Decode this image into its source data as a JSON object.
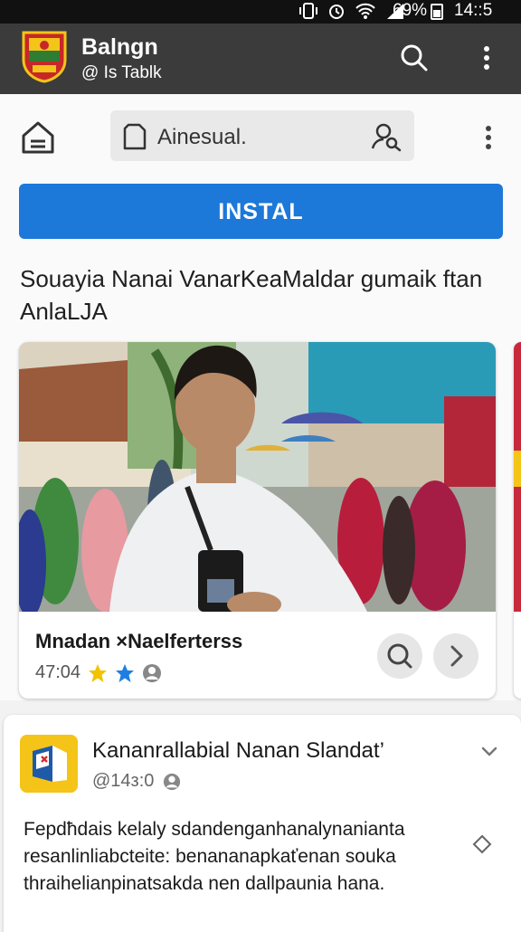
{
  "status_bar": {
    "battery": "69%",
    "time": "14::5"
  },
  "app_bar": {
    "title": "Balngn",
    "subtitle": "@ Is Tablk",
    "icons": [
      "emblem-logo",
      "search-icon",
      "more-vert-icon"
    ]
  },
  "search": {
    "value": "Ainesual.",
    "icons": [
      "home-icon",
      "document-icon",
      "user-search-icon",
      "more-vert-icon"
    ]
  },
  "install_button": {
    "label": "INSTAL"
  },
  "headline": "Souayia Nanai VanarKeaMaldar gumaik ftan AnlaLJA",
  "news_card": {
    "title": "Mnadan ×Naelferterss",
    "time": "47:04",
    "rating_icons": [
      "star-icon",
      "star-icon",
      "user-circle-icon"
    ],
    "accent_colors": {
      "star1": "#f2c300",
      "star2": "#1f7fe0"
    },
    "actions": [
      "search-icon",
      "chevron-right-icon"
    ]
  },
  "post_card": {
    "title": "Kananrallabial Nanan Slandat’",
    "handle": "@14з:0",
    "body": "Fepdħdais kelaly sdandenganhanalynanianta resanlinliabcteite: benananapkaťenan souka thraihelianpinatsakda nen dallpaunia hana.",
    "icons": [
      "app-logo",
      "chevron-down-icon",
      "diamond-icon",
      "user-circle-icon"
    ]
  },
  "colors": {
    "status_bar": "#111111",
    "app_bar": "#3b3b3b",
    "install_button": "#1c78d9",
    "background": "#f2f2f2"
  }
}
